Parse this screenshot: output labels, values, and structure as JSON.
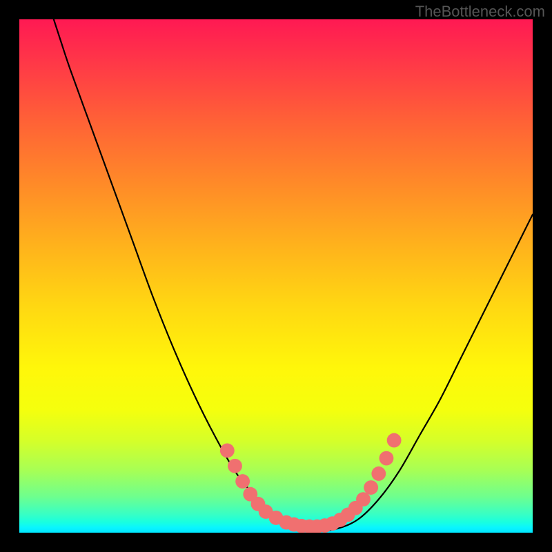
{
  "watermark_text": "TheBottleneck.com",
  "chart_data": {
    "type": "line",
    "title": "",
    "xlabel": "",
    "ylabel": "",
    "xlim": [
      0,
      100
    ],
    "ylim": [
      0,
      100
    ],
    "grid": false,
    "legend": false,
    "background": "heat-gradient",
    "curve": {
      "name": "bottleneck-curve",
      "points": [
        {
          "x": 6.7,
          "y": 100
        },
        {
          "x": 8,
          "y": 96
        },
        {
          "x": 10,
          "y": 90
        },
        {
          "x": 14,
          "y": 79
        },
        {
          "x": 18,
          "y": 68
        },
        {
          "x": 22,
          "y": 57
        },
        {
          "x": 26,
          "y": 46
        },
        {
          "x": 30,
          "y": 36
        },
        {
          "x": 34,
          "y": 27
        },
        {
          "x": 38,
          "y": 19
        },
        {
          "x": 42,
          "y": 12
        },
        {
          "x": 46,
          "y": 7
        },
        {
          "x": 50,
          "y": 3.2
        },
        {
          "x": 54,
          "y": 1.2
        },
        {
          "x": 58,
          "y": 0.4
        },
        {
          "x": 62,
          "y": 0.8
        },
        {
          "x": 66,
          "y": 2.6
        },
        {
          "x": 70,
          "y": 6.5
        },
        {
          "x": 74,
          "y": 12
        },
        {
          "x": 78,
          "y": 19
        },
        {
          "x": 82,
          "y": 26
        },
        {
          "x": 86,
          "y": 34
        },
        {
          "x": 90,
          "y": 42
        },
        {
          "x": 94,
          "y": 50
        },
        {
          "x": 98,
          "y": 58
        },
        {
          "x": 100,
          "y": 62
        }
      ]
    },
    "markers": {
      "name": "sample-dots",
      "color": "#f07070",
      "radius_pct": 1.4,
      "points": [
        {
          "x": 40.5,
          "y": 16
        },
        {
          "x": 42,
          "y": 13
        },
        {
          "x": 43.5,
          "y": 10
        },
        {
          "x": 45,
          "y": 7.5
        },
        {
          "x": 46.5,
          "y": 5.6
        },
        {
          "x": 48,
          "y": 4.1
        },
        {
          "x": 50,
          "y": 2.9
        },
        {
          "x": 52,
          "y": 2.0
        },
        {
          "x": 53.5,
          "y": 1.6
        },
        {
          "x": 55,
          "y": 1.3
        },
        {
          "x": 56.5,
          "y": 1.2
        },
        {
          "x": 58,
          "y": 1.2
        },
        {
          "x": 59.5,
          "y": 1.4
        },
        {
          "x": 61,
          "y": 1.8
        },
        {
          "x": 62.5,
          "y": 2.5
        },
        {
          "x": 64,
          "y": 3.5
        },
        {
          "x": 65.5,
          "y": 4.8
        },
        {
          "x": 67,
          "y": 6.5
        },
        {
          "x": 68.5,
          "y": 8.8
        },
        {
          "x": 70,
          "y": 11.5
        },
        {
          "x": 71.5,
          "y": 14.5
        },
        {
          "x": 73,
          "y": 18
        }
      ]
    }
  }
}
